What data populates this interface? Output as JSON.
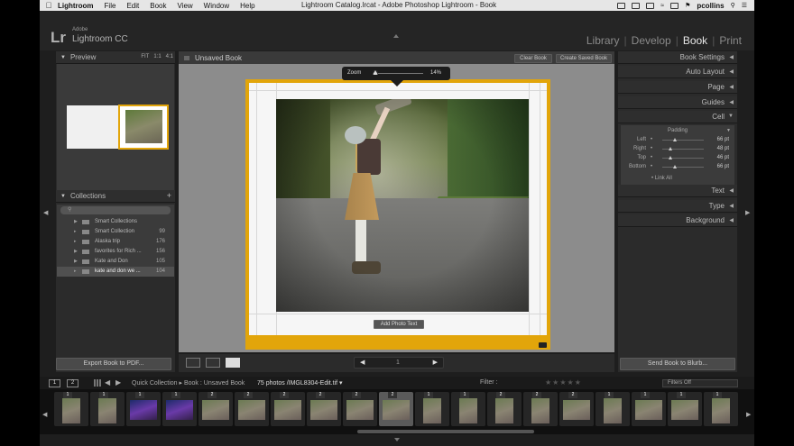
{
  "menubar": {
    "app": "Lightroom",
    "items": [
      "File",
      "Edit",
      "Book",
      "View",
      "Window",
      "Help"
    ],
    "title": "Lightroom Catalog.lrcat - Adobe Photoshop Lightroom - Book",
    "user": "pcollins"
  },
  "identity": {
    "logo_mark": "Lr",
    "adobe": "Adobe",
    "product": "Lightroom CC"
  },
  "modules": [
    {
      "label": "Library",
      "active": false
    },
    {
      "label": "Develop",
      "active": false
    },
    {
      "label": "Book",
      "active": true
    },
    {
      "label": "Print",
      "active": false
    }
  ],
  "left_panel": {
    "preview_title": "Preview",
    "preview_options": [
      "FIT",
      "1:1",
      "4:1"
    ],
    "collections_title": "Collections",
    "collections_add": "+",
    "collections": [
      {
        "name": "Smart Collections",
        "count": ""
      },
      {
        "name": "Smart Collection",
        "count": "99"
      },
      {
        "name": "Alaska trip",
        "count": "176"
      },
      {
        "name": "favorites for Rich ...",
        "count": "156"
      },
      {
        "name": "Kate and Don",
        "count": "105"
      },
      {
        "name": "kate and don we ...",
        "count": "104"
      }
    ],
    "export_button": "Export Book to PDF..."
  },
  "center": {
    "book_title": "Unsaved Book",
    "clear_button": "Clear Book",
    "save_button": "Create Saved Book",
    "zoom_label": "Zoom",
    "zoom_value": "14%",
    "add_photo_text": "Add Photo Text",
    "page_number": "1"
  },
  "right_panel": {
    "sections": [
      "Book Settings",
      "Auto Layout",
      "Page",
      "Guides",
      "Cell"
    ],
    "cell_padding_title": "Padding",
    "padding": [
      {
        "label": "Left",
        "value": "66 pt",
        "fraction": 0.3
      },
      {
        "label": "Right",
        "value": "48 pt",
        "fraction": 0.2
      },
      {
        "label": "Top",
        "value": "46 pt",
        "fraction": 0.2
      },
      {
        "label": "Bottom",
        "value": "66 pt",
        "fraction": 0.3
      }
    ],
    "link_all": "Link All",
    "lower_sections": [
      "Text",
      "Type",
      "Background"
    ],
    "send_button": "Send Book to Blurb..."
  },
  "filmstrip_bar": {
    "view_buttons": [
      "1",
      "2"
    ],
    "source": "Quick Collection  ▸  Book : Unsaved Book",
    "photos": "75 photos /IMGL8304-Edit.tif ▾",
    "filter_label": "Filter :",
    "filters_off": "Filters Off"
  },
  "filmstrip": {
    "selected_index": 9,
    "badges": [
      "1",
      "1",
      "1",
      "1",
      "2",
      "2",
      "2",
      "2",
      "2",
      "2",
      "1",
      "1",
      "2",
      "2",
      "2",
      "1",
      "1",
      "1",
      "1"
    ]
  },
  "colors": {
    "accent_selection": "#e2a50a",
    "panel_bg": "#2b2b2b",
    "canvas_bg": "#8c8c8c"
  }
}
